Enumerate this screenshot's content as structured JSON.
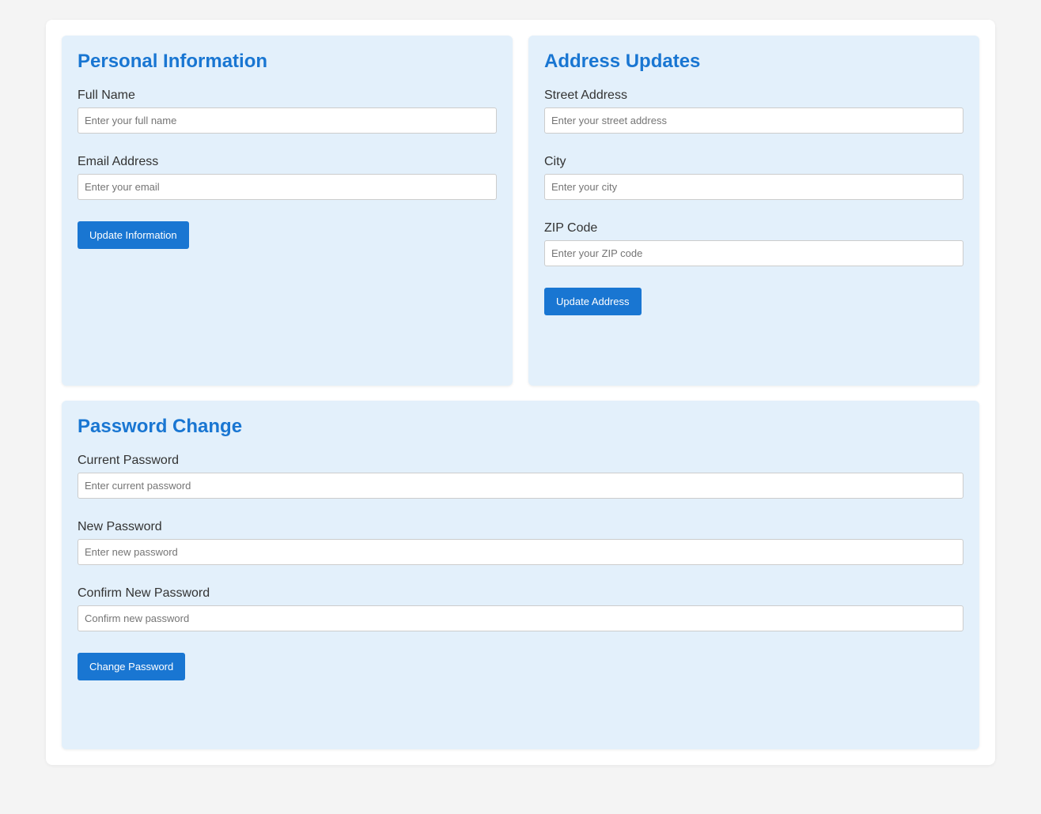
{
  "personal": {
    "title": "Personal Information",
    "full_name": {
      "label": "Full Name",
      "placeholder": "Enter your full name",
      "value": ""
    },
    "email": {
      "label": "Email Address",
      "placeholder": "Enter your email",
      "value": ""
    },
    "submit_label": "Update Information"
  },
  "address": {
    "title": "Address Updates",
    "street": {
      "label": "Street Address",
      "placeholder": "Enter your street address",
      "value": ""
    },
    "city": {
      "label": "City",
      "placeholder": "Enter your city",
      "value": ""
    },
    "zip": {
      "label": "ZIP Code",
      "placeholder": "Enter your ZIP code",
      "value": ""
    },
    "submit_label": "Update Address"
  },
  "password": {
    "title": "Password Change",
    "current": {
      "label": "Current Password",
      "placeholder": "Enter current password",
      "value": ""
    },
    "new": {
      "label": "New Password",
      "placeholder": "Enter new password",
      "value": ""
    },
    "confirm": {
      "label": "Confirm New Password",
      "placeholder": "Confirm new password",
      "value": ""
    },
    "submit_label": "Change Password"
  },
  "colors": {
    "accent": "#1976d2",
    "section_bg": "#e3f0fb",
    "page_bg": "#f4f4f4"
  }
}
